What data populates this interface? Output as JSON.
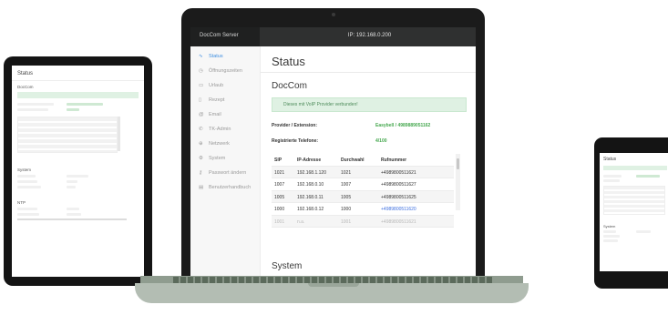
{
  "app": {
    "brand": "DocCom Server",
    "ip_label": "IP: 192.168.0.200"
  },
  "sidebar": {
    "items": [
      {
        "icon": "heartbeat-icon",
        "glyph": "∿",
        "label": "Status",
        "active": true
      },
      {
        "icon": "clock-icon",
        "glyph": "◷",
        "label": "Öffnungszeiten"
      },
      {
        "icon": "suitcase-icon",
        "glyph": "▭",
        "label": "Urlaub"
      },
      {
        "icon": "clipboard-icon",
        "glyph": "▯",
        "label": "Rezept"
      },
      {
        "icon": "at-icon",
        "glyph": "@",
        "label": "Email"
      },
      {
        "icon": "phone-icon",
        "glyph": "✆",
        "label": "TK-Admin"
      },
      {
        "icon": "network-icon",
        "glyph": "⊕",
        "label": "Netzwerk"
      },
      {
        "icon": "gear-icon",
        "glyph": "⚙",
        "label": "System"
      },
      {
        "icon": "key-icon",
        "glyph": "⚷",
        "label": "Passwort ändern"
      },
      {
        "icon": "book-icon",
        "glyph": "▤",
        "label": "Benutzerhandbuch"
      }
    ]
  },
  "main": {
    "title": "Status",
    "section_title": "DocCom",
    "alert": "Dieses mit VoIP Provider verbunden!",
    "provider_label": "Provider / Extension:",
    "provider_value": "Easybell / 4989889051162",
    "phones_label": "Registrierte Telefone:",
    "phones_value": "4/100",
    "table": {
      "headers": [
        "SIP",
        "IP-Adresse",
        "Durchwahl",
        "Rufnummer"
      ],
      "rows": [
        [
          "1021",
          "192.168.1.120",
          "1021",
          "+498980051162​1"
        ],
        [
          "1007",
          "192.168.0.10",
          "1007",
          "+498980051162​7"
        ],
        [
          "1005",
          "192.168.0.11",
          "1005",
          "+498980051162​5"
        ],
        [
          "1000",
          "192.168.0.12",
          "1000",
          "+498980051162​0"
        ],
        [
          "1001",
          "n.a.",
          "1001",
          "+498980051162​1"
        ]
      ]
    },
    "next_section": "System"
  },
  "tablet": {
    "title": "Status",
    "section": "DocCom",
    "system": "System",
    "ntp": "NTP"
  },
  "phone": {
    "title": "Status",
    "section": "System"
  },
  "colors": {
    "topbar": "#2f3030",
    "accent": "#3d8ee0",
    "success": "#46a84f",
    "alert_bg": "#dff1e3"
  }
}
